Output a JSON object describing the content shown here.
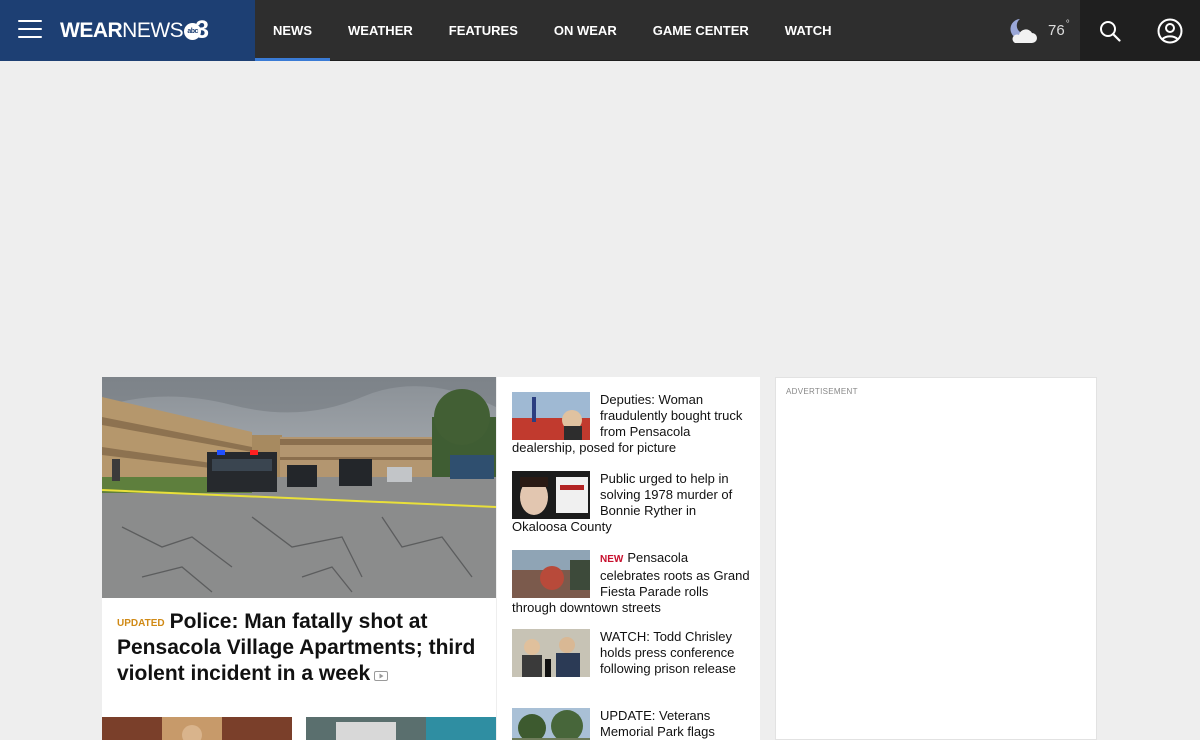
{
  "header": {
    "brand_bold": "WEAR",
    "brand_light": "NEWS",
    "brand_badge_text": "abc",
    "brand_badge_number": "3",
    "nav": [
      {
        "label": "NEWS",
        "active": true
      },
      {
        "label": "WEATHER"
      },
      {
        "label": "FEATURES"
      },
      {
        "label": "ON WEAR"
      },
      {
        "label": "GAME CENTER"
      },
      {
        "label": "WATCH"
      }
    ],
    "weather": {
      "temp": "76",
      "degree_symbol": "°",
      "icon": "moon-cloud-icon"
    },
    "icons": [
      "menu-icon",
      "search-icon",
      "account-icon"
    ]
  },
  "feature": {
    "tag": "UPDATED",
    "title": "Police: Man fatally shot at Pensacola Village Apartments; third violent incident in a week"
  },
  "stories": [
    {
      "tag": "",
      "title": "Deputies: Woman fraudulently bought truck from Pensacola dealership, posed for picture"
    },
    {
      "tag": "",
      "title": "Public urged to help in solving 1978 murder of Bonnie Ryther in Okaloosa County"
    },
    {
      "tag": "NEW",
      "title": "Pensacola celebrates roots as Grand Fiesta Parade rolls through downtown streets"
    },
    {
      "tag": "",
      "title": "WATCH: Todd Chrisley holds press conference following prison release"
    },
    {
      "tag": "",
      "title": "UPDATE: Veterans Memorial Park flags"
    }
  ],
  "ad": {
    "label": "ADVERTISEMENT"
  },
  "colors": {
    "header_bg": "#2e2e2e",
    "brand_bg": "#1d3f73",
    "accent": "#3a7bd5",
    "updated": "#d08a16",
    "new": "#c8102e"
  }
}
